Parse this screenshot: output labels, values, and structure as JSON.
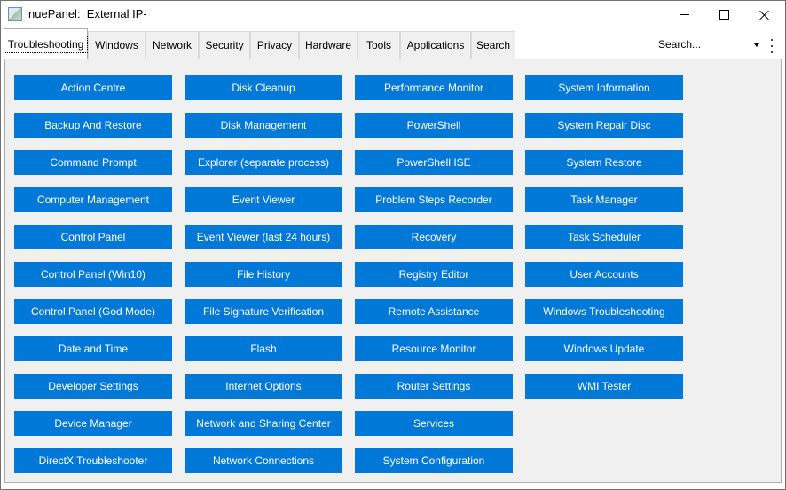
{
  "window": {
    "title": "nuePanel:  External IP-"
  },
  "tabs": [
    {
      "label": "Troubleshooting",
      "active": true
    },
    {
      "label": "Windows"
    },
    {
      "label": "Network"
    },
    {
      "label": "Security"
    },
    {
      "label": "Privacy"
    },
    {
      "label": "Hardware"
    },
    {
      "label": "Tools"
    },
    {
      "label": "Applications"
    },
    {
      "label": "Search"
    }
  ],
  "search": {
    "value": "Search..."
  },
  "theme": {
    "button_color": "#0078d7",
    "button_text_color": "#ffffff",
    "panel_background": "#f0f0f0"
  },
  "icons": {
    "app": "app-icon",
    "minimize": "minimize-icon",
    "maximize": "maximize-icon",
    "close": "close-icon",
    "dropdown": "chevron-down-icon",
    "more": "kebab-menu-icon"
  },
  "columns": [
    [
      "Action Centre",
      "Backup And Restore",
      "Command Prompt",
      "Computer Management",
      "Control Panel",
      "Control Panel (Win10)",
      "Control Panel (God Mode)",
      "Date and Time",
      "Developer Settings",
      "Device Manager",
      "DirectX Troubleshooter"
    ],
    [
      "Disk Cleanup",
      "Disk Management",
      "Explorer (separate process)",
      "Event Viewer",
      "Event Viewer (last 24 hours)",
      "File History",
      "File Signature Verification",
      "Flash",
      "Internet Options",
      "Network and Sharing Center",
      "Network Connections"
    ],
    [
      "Performance Monitor",
      "PowerShell",
      "PowerShell ISE",
      "Problem Steps Recorder",
      "Recovery",
      "Registry Editor",
      "Remote Assistance",
      "Resource Monitor",
      "Router Settings",
      "Services",
      "System Configuration"
    ],
    [
      "System Information",
      "System Repair Disc",
      "System Restore",
      "Task Manager",
      "Task Scheduler",
      "User Accounts",
      "Windows Troubleshooting",
      "Windows Update",
      "WMI Tester"
    ]
  ]
}
